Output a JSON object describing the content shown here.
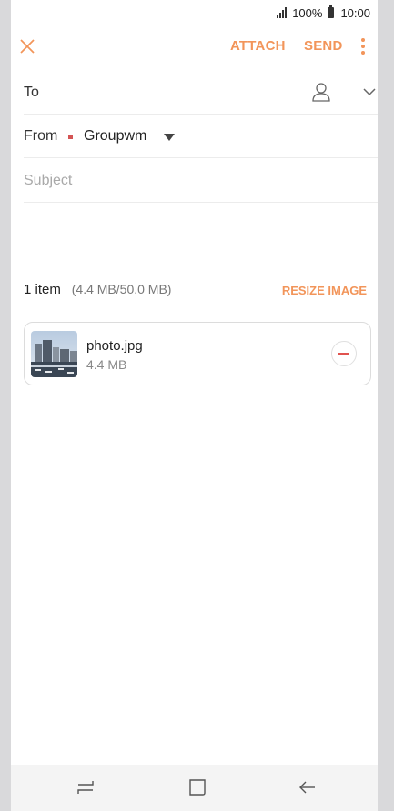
{
  "status": {
    "signal_icon": "signal-icon",
    "battery_percent": "100%",
    "battery_icon": "battery-icon",
    "time": "10:00"
  },
  "toolbar": {
    "close_icon": "close-icon",
    "attach_label": "ATTACH",
    "send_label": "SEND",
    "more_icon": "more-vertical-icon"
  },
  "compose": {
    "to_label": "To",
    "from_label": "From",
    "from_value": "Groupwm",
    "subject_placeholder": "Subject"
  },
  "attachments": {
    "count_label": "1 item",
    "size_summary": "(4.4 MB/50.0 MB)",
    "resize_label": "RESIZE IMAGE",
    "items": [
      {
        "name": "photo.jpg",
        "size": "4.4 MB"
      }
    ]
  },
  "colors": {
    "accent": "#f2955a",
    "remove": "#e0534f",
    "account_dot": "#d45454"
  },
  "navbar": {
    "recent_icon": "recent-apps-icon",
    "home_icon": "home-icon",
    "back_icon": "back-icon"
  }
}
